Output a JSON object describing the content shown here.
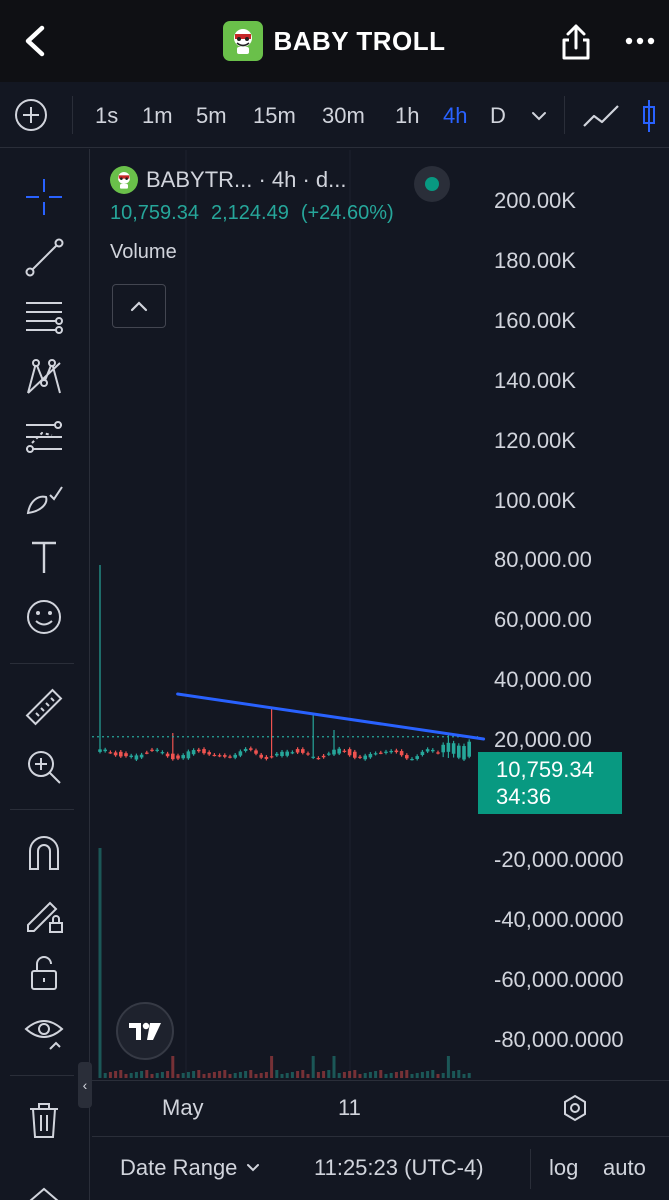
{
  "header": {
    "title": "BABY TROLL",
    "back_icon": "chevron-left-icon",
    "share_icon": "share-icon",
    "more_icon": "more-horizontal-icon"
  },
  "timeframes": [
    {
      "label": "1s",
      "active": false
    },
    {
      "label": "1m",
      "active": false
    },
    {
      "label": "5m",
      "active": false
    },
    {
      "label": "15m",
      "active": false
    },
    {
      "label": "30m",
      "active": false
    },
    {
      "label": "1h",
      "active": false
    },
    {
      "label": "4h",
      "active": true
    },
    {
      "label": "D",
      "active": false
    }
  ],
  "tools": [
    "crosshair-icon",
    "trend-line-icon",
    "fib-retracement-icon",
    "pattern-icon",
    "prediction-icon",
    "brush-icon",
    "text-icon",
    "emoji-icon",
    "ruler-icon",
    "zoom-in-icon",
    "magnet-icon",
    "lock-drawing-icon",
    "unlock-icon",
    "eye-icon",
    "trash-icon"
  ],
  "legend": {
    "symbol": "BABYTR... · 4h · d...",
    "price": "10,759.34",
    "change": "2,124.49",
    "change_pct": "(+24.60%)",
    "volume_label": "Volume"
  },
  "price_label": {
    "price": "10,759.34",
    "countdown": "34:36"
  },
  "time_axis": {
    "ticks": [
      "May",
      "11"
    ]
  },
  "bottom_bar": {
    "date_range": "Date Range",
    "clock": "11:25:23 (UTC-4)",
    "log": "log",
    "auto": "auto"
  },
  "colors": {
    "up": "#26a69a",
    "down": "#ef5350",
    "trendline": "#2962ff",
    "accent": "#2962ff",
    "price_label_bg": "#089981"
  },
  "chart_data": {
    "type": "candlestick",
    "timeframe": "4h",
    "last_price": 10759.34,
    "y_ticks": [
      "200.00K",
      "180.00K",
      "160.00K",
      "140.00K",
      "120.00K",
      "100.00K",
      "80,000.00",
      "60,000.00",
      "40,000.00",
      "20,000.00",
      "-20,000.0000",
      "-40,000.0000",
      "-60,000.0000",
      "-80,000.0000"
    ],
    "ylim": [
      -90000,
      210000
    ],
    "x_ticks": [
      "May",
      "11"
    ],
    "spikes": [
      {
        "t": 0,
        "high": 68000
      },
      {
        "t": 14,
        "high": 12000
      },
      {
        "t": 33,
        "high": 20000
      },
      {
        "t": 41,
        "high": 18000
      },
      {
        "t": 45,
        "high": 13000
      },
      {
        "t": 67,
        "high": 12000
      }
    ],
    "baseline": 5000,
    "trendline": {
      "start": {
        "t": 13,
        "value": 25000
      },
      "end": {
        "t": 68,
        "value": 10000
      }
    }
  }
}
